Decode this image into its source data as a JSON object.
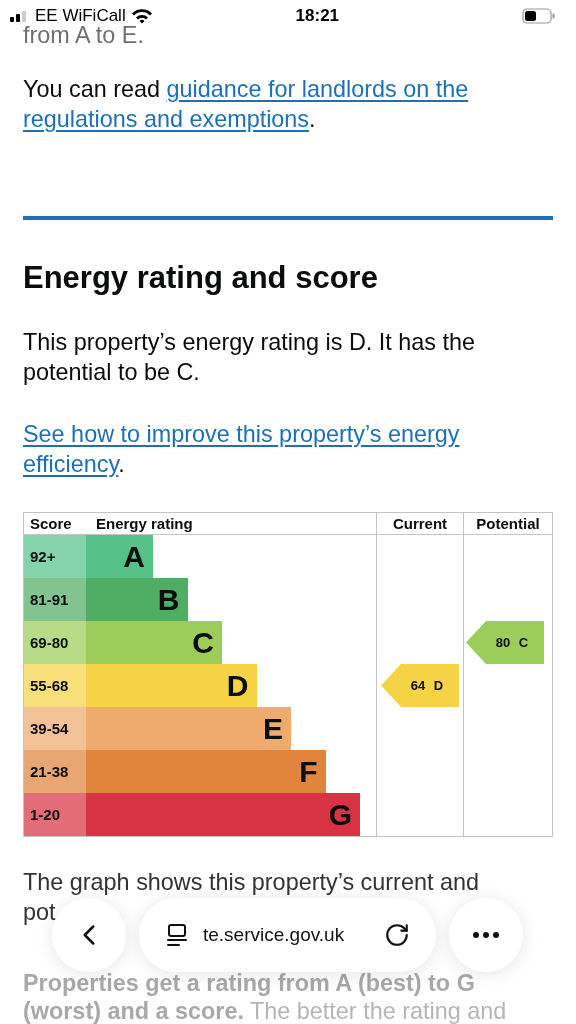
{
  "status_bar": {
    "carrier": "EE WiFiCall",
    "time": "18:21"
  },
  "intro": "from A to E.",
  "guidance": {
    "prefix": "You can read",
    "link_lines": [
      "guidance for landlords on the",
      "regulations and exemptions"
    ],
    "suffix": "."
  },
  "section": {
    "heading": "Energy rating and score",
    "description": "This property’s energy rating is D. It has the potential to be C.",
    "improve_link_lines": [
      "See how to improve this property’s energy",
      "efficiency"
    ],
    "improve_suffix": "."
  },
  "rating_table": {
    "columns": [
      "Score",
      "Energy rating",
      "Current",
      "Potential"
    ],
    "rows": [
      {
        "score": "92+",
        "band": "A",
        "color": "#56c28a"
      },
      {
        "score": "81-91",
        "band": "B",
        "color": "#50ad64"
      },
      {
        "score": "69-80",
        "band": "C",
        "color": "#9ccd5a",
        "potential": "80 C"
      },
      {
        "score": "55-68",
        "band": "D",
        "color": "#f6d245",
        "current": "64 D"
      },
      {
        "score": "39-54",
        "band": "E",
        "color": "#efaa6e"
      },
      {
        "score": "21-38",
        "band": "F",
        "color": "#e1843c"
      },
      {
        "score": "1-20",
        "band": "G",
        "color": "#d73342"
      }
    ]
  },
  "graph_note_lines": [
    "The graph shows this property’s current and",
    "pot"
  ],
  "rating_note_lines": [
    "**Properties get a rating from A (best) to G**",
    "**(worst) and a score.** The better the rating and"
  ],
  "browser_toolbar": {
    "url": "te.service.gov.uk"
  }
}
